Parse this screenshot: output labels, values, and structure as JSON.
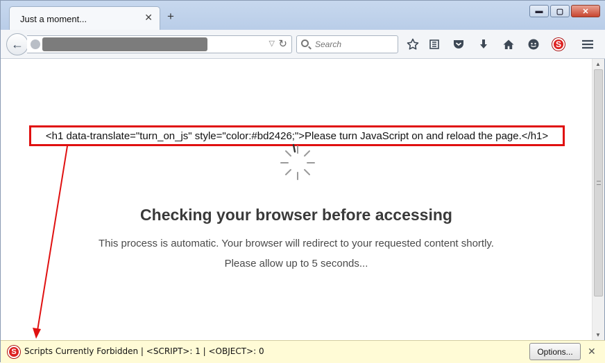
{
  "tab": {
    "title": "Just a moment...",
    "close_glyph": "✕",
    "new_tab_glyph": "+"
  },
  "window_controls": {
    "minimize": "▬",
    "maximize": "▢",
    "close": "✕"
  },
  "navbar": {
    "back_glyph": "←",
    "url_dropdown_glyph": "▽",
    "reload_glyph": "↻",
    "search_placeholder": "Search",
    "icons": [
      "star-icon",
      "reading-list-icon",
      "pocket-icon",
      "download-icon",
      "home-icon",
      "chat-icon",
      "noscript-icon",
      "menu-icon"
    ]
  },
  "annotation": {
    "code": "<h1 data-translate=\"turn_on_js\" style=\"color:#bd2426;\">Please turn JavaScript on and reload the page.</h1>",
    "color": "#e01010"
  },
  "page": {
    "heading": "Checking your browser before accessing",
    "line1": "This process is automatic. Your browser will redirect to your requested content shortly.",
    "line2": "Please allow up to 5 seconds..."
  },
  "notification": {
    "text": "Scripts Currently Forbidden | <SCRIPT>: 1 | <OBJECT>: 0",
    "options_label": "Options...",
    "close_glyph": "✕",
    "icon_letter": "S"
  }
}
